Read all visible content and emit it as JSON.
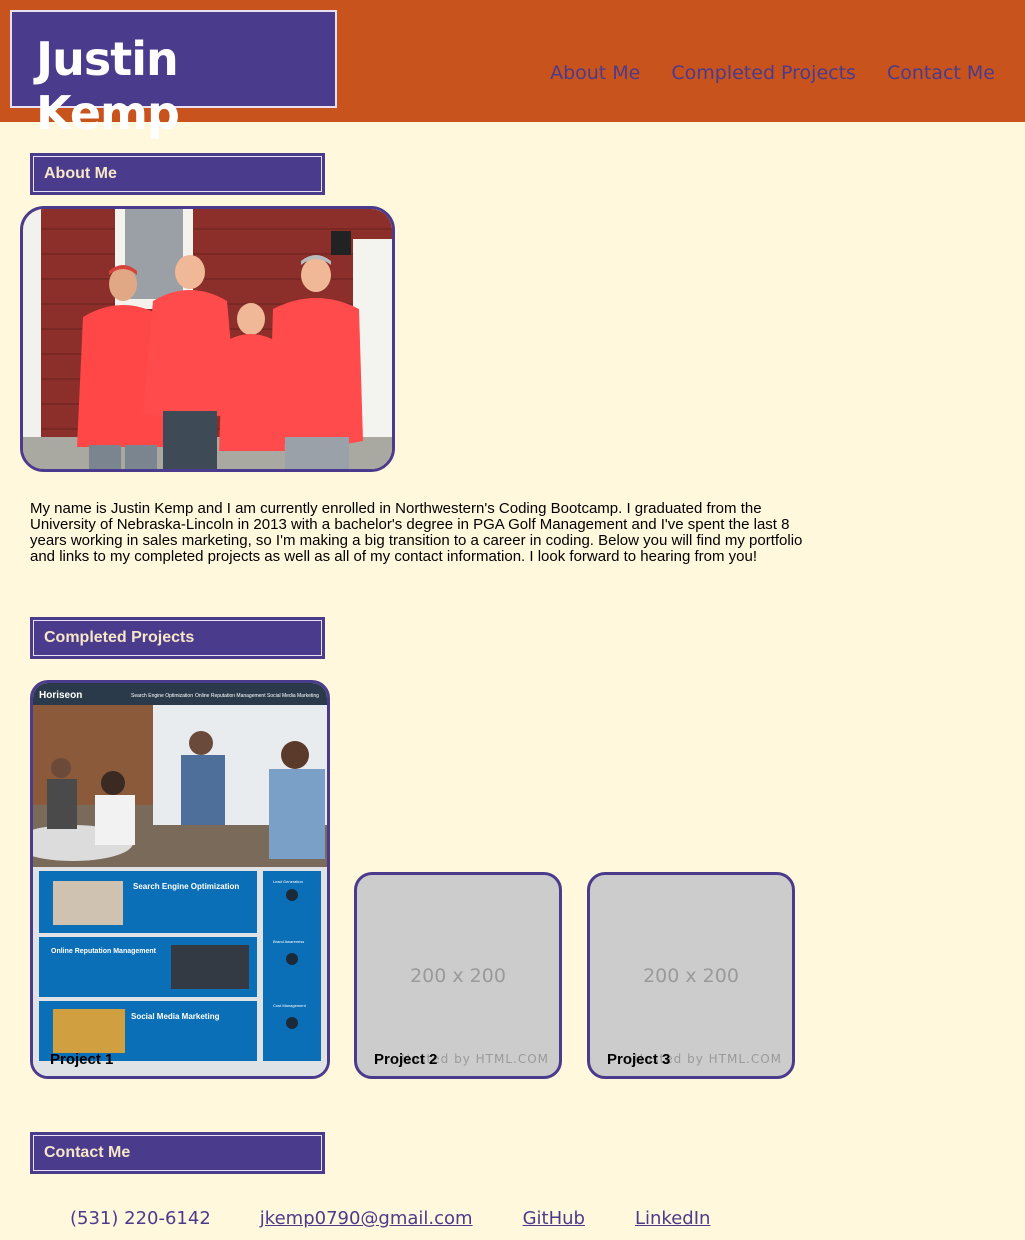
{
  "header": {
    "name": "Justin Kemp",
    "nav": [
      "About Me",
      "Completed Projects",
      "Contact Me"
    ]
  },
  "about": {
    "title": "About Me",
    "text": "My name is Justin Kemp and I am currently enrolled in Northwestern's Coding Bootcamp. I graduated from the University of Nebraska-Lincoln in 2013 with a bachelor's degree in PGA Golf Management and I've spent the last 8 years working in sales marketing, so I'm making a big transition to a career in coding. Below you will find my portfolio and links to my completed projects as well as all of my contact information. I look forward to hearing from you!"
  },
  "projects": {
    "title": "Completed Projects",
    "items": [
      {
        "label": "Project 1",
        "site_name": "Horiseon",
        "site_nav": [
          "Search Engine Optimization",
          "Online Reputation Management",
          "Social Media Marketing"
        ],
        "cards": [
          "Search Engine Optimization",
          "Online Reputation Management",
          "Social Media Marketing"
        ],
        "side": [
          "Lead Generation",
          "Brand Awareness",
          "Cost Management"
        ]
      },
      {
        "label": "Project 2",
        "placeholder": "200 x 200",
        "watermark": "Hosted by HTML.COM"
      },
      {
        "label": "Project 3",
        "placeholder": "200 x 200",
        "watermark": "Hosted by HTML.COM"
      }
    ]
  },
  "contact": {
    "title": "Contact Me",
    "phone": "(531) 220-6142",
    "email": "jkemp0790@gmail.com",
    "github": "GitHub",
    "linkedin": "LinkedIn"
  },
  "colors": {
    "header": "#c8531c",
    "accent": "#4b3b8c",
    "background": "#fff8dc"
  }
}
